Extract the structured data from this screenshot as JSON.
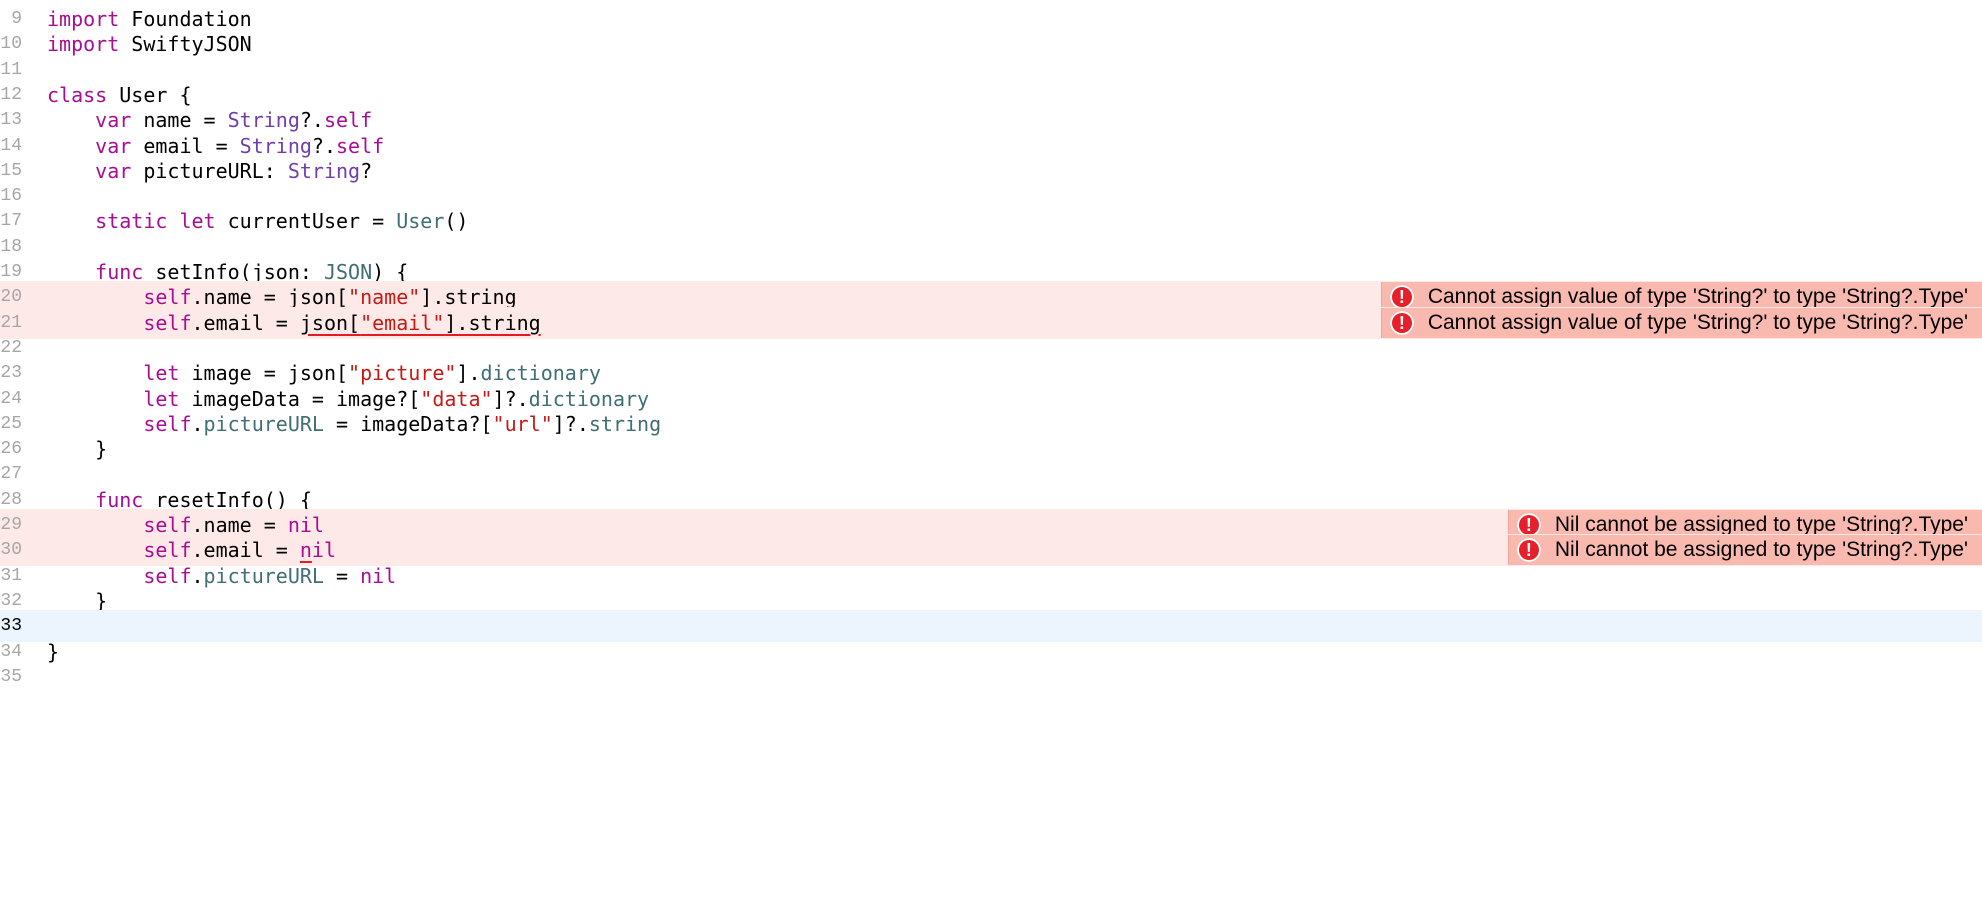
{
  "editor": {
    "lines": [
      {
        "num": "9",
        "state": "normal",
        "tokens": [
          {
            "t": "import",
            "c": "kw"
          },
          {
            "t": " Foundation"
          }
        ]
      },
      {
        "num": "10",
        "state": "normal",
        "tokens": [
          {
            "t": "import",
            "c": "kw"
          },
          {
            "t": " SwiftyJSON"
          }
        ]
      },
      {
        "num": "11",
        "state": "normal",
        "tokens": []
      },
      {
        "num": "12",
        "state": "normal",
        "tokens": [
          {
            "t": "class",
            "c": "kw"
          },
          {
            "t": " User {"
          }
        ]
      },
      {
        "num": "13",
        "state": "normal",
        "tokens": [
          {
            "t": "    "
          },
          {
            "t": "var",
            "c": "kw"
          },
          {
            "t": " name = "
          },
          {
            "t": "String",
            "c": "ty"
          },
          {
            "t": "?."
          },
          {
            "t": "self",
            "c": "kw"
          }
        ]
      },
      {
        "num": "14",
        "state": "normal",
        "tokens": [
          {
            "t": "    "
          },
          {
            "t": "var",
            "c": "kw"
          },
          {
            "t": " email = "
          },
          {
            "t": "String",
            "c": "ty"
          },
          {
            "t": "?."
          },
          {
            "t": "self",
            "c": "kw"
          }
        ]
      },
      {
        "num": "15",
        "state": "normal",
        "tokens": [
          {
            "t": "    "
          },
          {
            "t": "var",
            "c": "kw"
          },
          {
            "t": " pictureURL: "
          },
          {
            "t": "String",
            "c": "ty"
          },
          {
            "t": "?"
          }
        ]
      },
      {
        "num": "16",
        "state": "normal",
        "tokens": []
      },
      {
        "num": "17",
        "state": "normal",
        "tokens": [
          {
            "t": "    "
          },
          {
            "t": "static",
            "c": "kw"
          },
          {
            "t": " "
          },
          {
            "t": "let",
            "c": "kw"
          },
          {
            "t": " currentUser = "
          },
          {
            "t": "User",
            "c": "pr"
          },
          {
            "t": "()"
          }
        ]
      },
      {
        "num": "18",
        "state": "normal",
        "tokens": []
      },
      {
        "num": "19",
        "state": "normal",
        "tokens": [
          {
            "t": "    "
          },
          {
            "t": "func",
            "c": "kw"
          },
          {
            "t": " setInfo(json: "
          },
          {
            "t": "JSON",
            "c": "pr"
          },
          {
            "t": ") {"
          }
        ]
      },
      {
        "num": "20",
        "state": "error",
        "tokens": [
          {
            "t": "        "
          },
          {
            "t": "self",
            "c": "kw"
          },
          {
            "t": ".name = "
          },
          {
            "t": "json[",
            "sq": true
          },
          {
            "t": "\"name\"",
            "c": "str",
            "sq": true
          },
          {
            "t": "].string",
            "sq": true
          }
        ],
        "issue": "Cannot assign value of type 'String?' to type 'String?.Type'"
      },
      {
        "num": "21",
        "state": "error",
        "tokens": [
          {
            "t": "        "
          },
          {
            "t": "self",
            "c": "kw"
          },
          {
            "t": ".email = "
          },
          {
            "t": "json[",
            "sq": true
          },
          {
            "t": "\"email\"",
            "c": "str",
            "sq": true
          },
          {
            "t": "].string",
            "sq": true
          }
        ],
        "issue": "Cannot assign value of type 'String?' to type 'String?.Type'"
      },
      {
        "num": "22",
        "state": "normal",
        "tokens": []
      },
      {
        "num": "23",
        "state": "normal",
        "tokens": [
          {
            "t": "        "
          },
          {
            "t": "let",
            "c": "kw"
          },
          {
            "t": " image = json["
          },
          {
            "t": "\"picture\"",
            "c": "str"
          },
          {
            "t": "]."
          },
          {
            "t": "dictionary",
            "c": "pr"
          }
        ]
      },
      {
        "num": "24",
        "state": "normal",
        "tokens": [
          {
            "t": "        "
          },
          {
            "t": "let",
            "c": "kw"
          },
          {
            "t": " imageData = image?["
          },
          {
            "t": "\"data\"",
            "c": "str"
          },
          {
            "t": "]?."
          },
          {
            "t": "dictionary",
            "c": "pr"
          }
        ]
      },
      {
        "num": "25",
        "state": "normal",
        "tokens": [
          {
            "t": "        "
          },
          {
            "t": "self",
            "c": "kw"
          },
          {
            "t": "."
          },
          {
            "t": "pictureURL",
            "c": "pr"
          },
          {
            "t": " = imageData?["
          },
          {
            "t": "\"url\"",
            "c": "str"
          },
          {
            "t": "]?."
          },
          {
            "t": "string",
            "c": "pr"
          }
        ]
      },
      {
        "num": "26",
        "state": "normal",
        "tokens": [
          {
            "t": "    }"
          }
        ]
      },
      {
        "num": "27",
        "state": "normal",
        "tokens": []
      },
      {
        "num": "28",
        "state": "normal",
        "tokens": [
          {
            "t": "    "
          },
          {
            "t": "func",
            "c": "kw"
          },
          {
            "t": " resetInfo() {"
          }
        ]
      },
      {
        "num": "29",
        "state": "error",
        "tokens": [
          {
            "t": "        "
          },
          {
            "t": "self",
            "c": "kw"
          },
          {
            "t": ".name = "
          },
          {
            "t": "n",
            "c": "kw",
            "sq": true
          },
          {
            "t": "il",
            "c": "kw"
          }
        ],
        "issue": "Nil cannot be assigned to type 'String?.Type'"
      },
      {
        "num": "30",
        "state": "error",
        "tokens": [
          {
            "t": "        "
          },
          {
            "t": "self",
            "c": "kw"
          },
          {
            "t": ".email = "
          },
          {
            "t": "n",
            "c": "kw",
            "sq": true
          },
          {
            "t": "il",
            "c": "kw"
          }
        ],
        "issue": "Nil cannot be assigned to type 'String?.Type'"
      },
      {
        "num": "31",
        "state": "normal",
        "tokens": [
          {
            "t": "        "
          },
          {
            "t": "self",
            "c": "kw"
          },
          {
            "t": "."
          },
          {
            "t": "pictureURL",
            "c": "pr"
          },
          {
            "t": " = "
          },
          {
            "t": "nil",
            "c": "kw"
          }
        ]
      },
      {
        "num": "32",
        "state": "normal",
        "tokens": [
          {
            "t": "    }"
          }
        ]
      },
      {
        "num": "33",
        "state": "current",
        "tokens": []
      },
      {
        "num": "34",
        "state": "normal",
        "tokens": [
          {
            "t": "}"
          }
        ]
      },
      {
        "num": "35",
        "state": "normal",
        "tokens": []
      }
    ]
  },
  "colors": {
    "keyword": "#a90d91",
    "type": "#703daa",
    "project": "#3f6e74",
    "string": "#c41a16",
    "error_line_bg": "#fdeae8",
    "error_banner_bg": "#f9b9ae",
    "error_icon": "#e5202b",
    "current_line_bg": "#ecf5fe",
    "gutter_text": "#a6a6a6"
  },
  "icons": {
    "issue": "error-circle-icon",
    "issue_glyph": "!"
  }
}
